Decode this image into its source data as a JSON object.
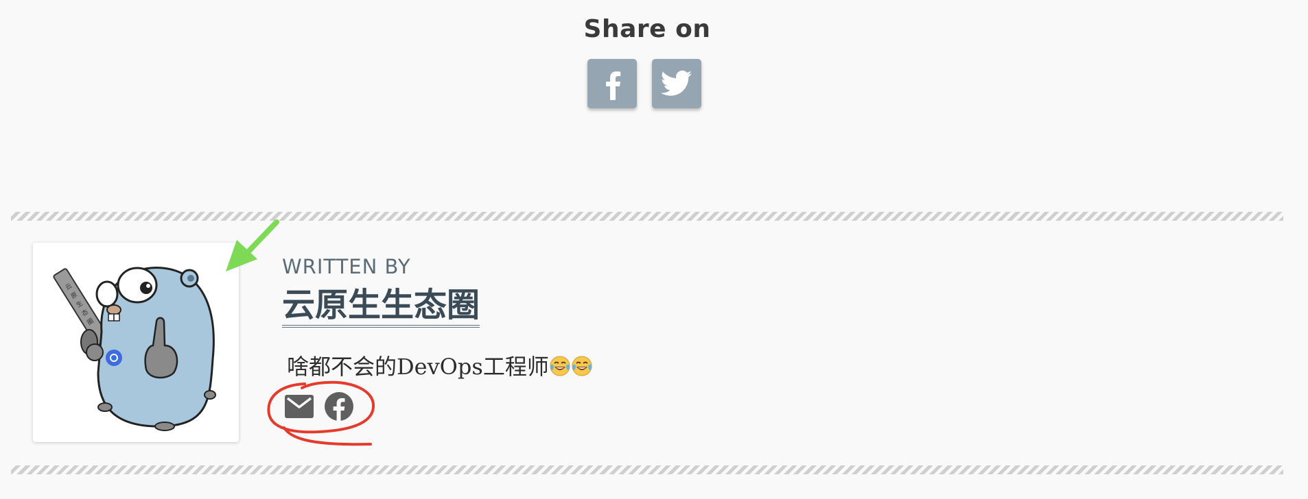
{
  "share": {
    "title": "Share on",
    "buttons": [
      {
        "name": "facebook",
        "icon": "facebook-icon"
      },
      {
        "name": "twitter",
        "icon": "twitter-icon"
      }
    ],
    "button_color": "#95a5b2"
  },
  "author": {
    "written_by": "WRITTEN BY",
    "name": "云原生生态圈",
    "bio": "啥都不会的DevOps工程师",
    "bio_emoji": [
      "😂",
      "😂"
    ],
    "avatar_icon": "gopher-avatar-icon",
    "social": [
      {
        "name": "email",
        "icon": "email-icon"
      },
      {
        "name": "facebook",
        "icon": "facebook-icon"
      }
    ]
  },
  "annotations": {
    "arrow_color": "#7ed957",
    "circle_color": "#e53b2c"
  }
}
